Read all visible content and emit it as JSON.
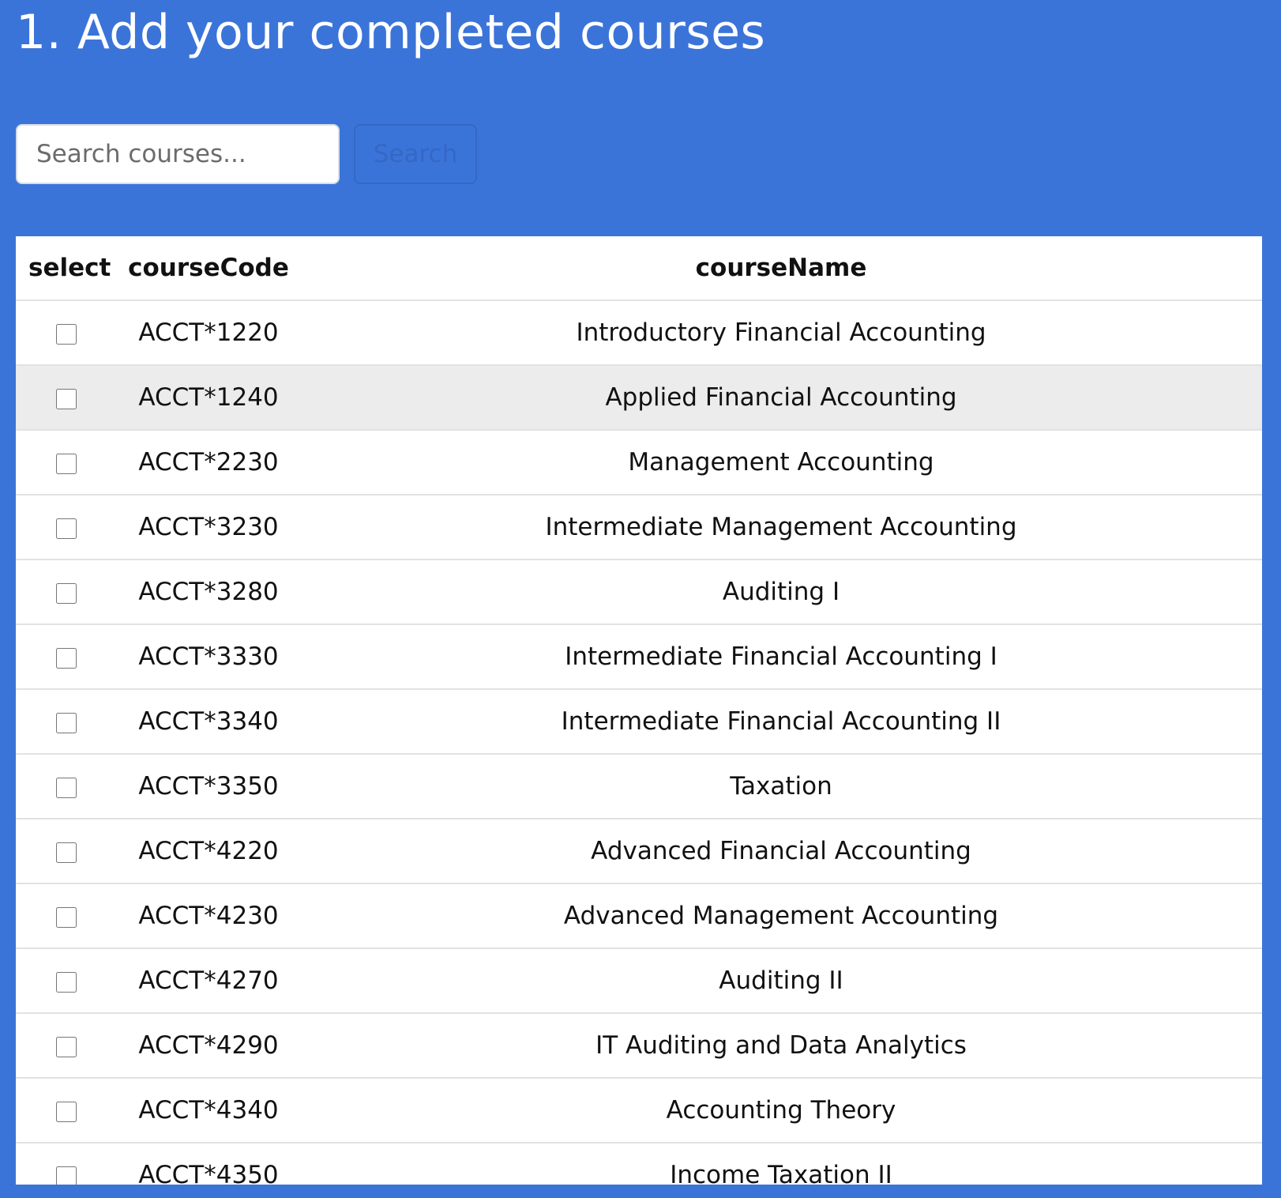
{
  "page": {
    "title": "1. Add your completed courses"
  },
  "search": {
    "placeholder": "Search courses...",
    "value": "",
    "button_label": "Search"
  },
  "table": {
    "columns": [
      "select",
      "courseCode",
      "courseName"
    ],
    "hovered_row": 1,
    "rows": [
      {
        "code": "ACCT*1220",
        "name": "Introductory Financial Accounting",
        "selected": false
      },
      {
        "code": "ACCT*1240",
        "name": "Applied Financial Accounting",
        "selected": false
      },
      {
        "code": "ACCT*2230",
        "name": "Management Accounting",
        "selected": false
      },
      {
        "code": "ACCT*3230",
        "name": "Intermediate Management Accounting",
        "selected": false
      },
      {
        "code": "ACCT*3280",
        "name": "Auditing I",
        "selected": false
      },
      {
        "code": "ACCT*3330",
        "name": "Intermediate Financial Accounting I",
        "selected": false
      },
      {
        "code": "ACCT*3340",
        "name": "Intermediate Financial Accounting II",
        "selected": false
      },
      {
        "code": "ACCT*3350",
        "name": "Taxation",
        "selected": false
      },
      {
        "code": "ACCT*4220",
        "name": "Advanced Financial Accounting",
        "selected": false
      },
      {
        "code": "ACCT*4230",
        "name": "Advanced Management Accounting",
        "selected": false
      },
      {
        "code": "ACCT*4270",
        "name": "Auditing II",
        "selected": false
      },
      {
        "code": "ACCT*4290",
        "name": "IT Auditing and Data Analytics",
        "selected": false
      },
      {
        "code": "ACCT*4340",
        "name": "Accounting Theory",
        "selected": false
      },
      {
        "code": "ACCT*4350",
        "name": "Income Taxation II",
        "selected": false
      }
    ]
  },
  "colors": {
    "page_background": "#3b74d9",
    "row_hover": "#ececec"
  }
}
